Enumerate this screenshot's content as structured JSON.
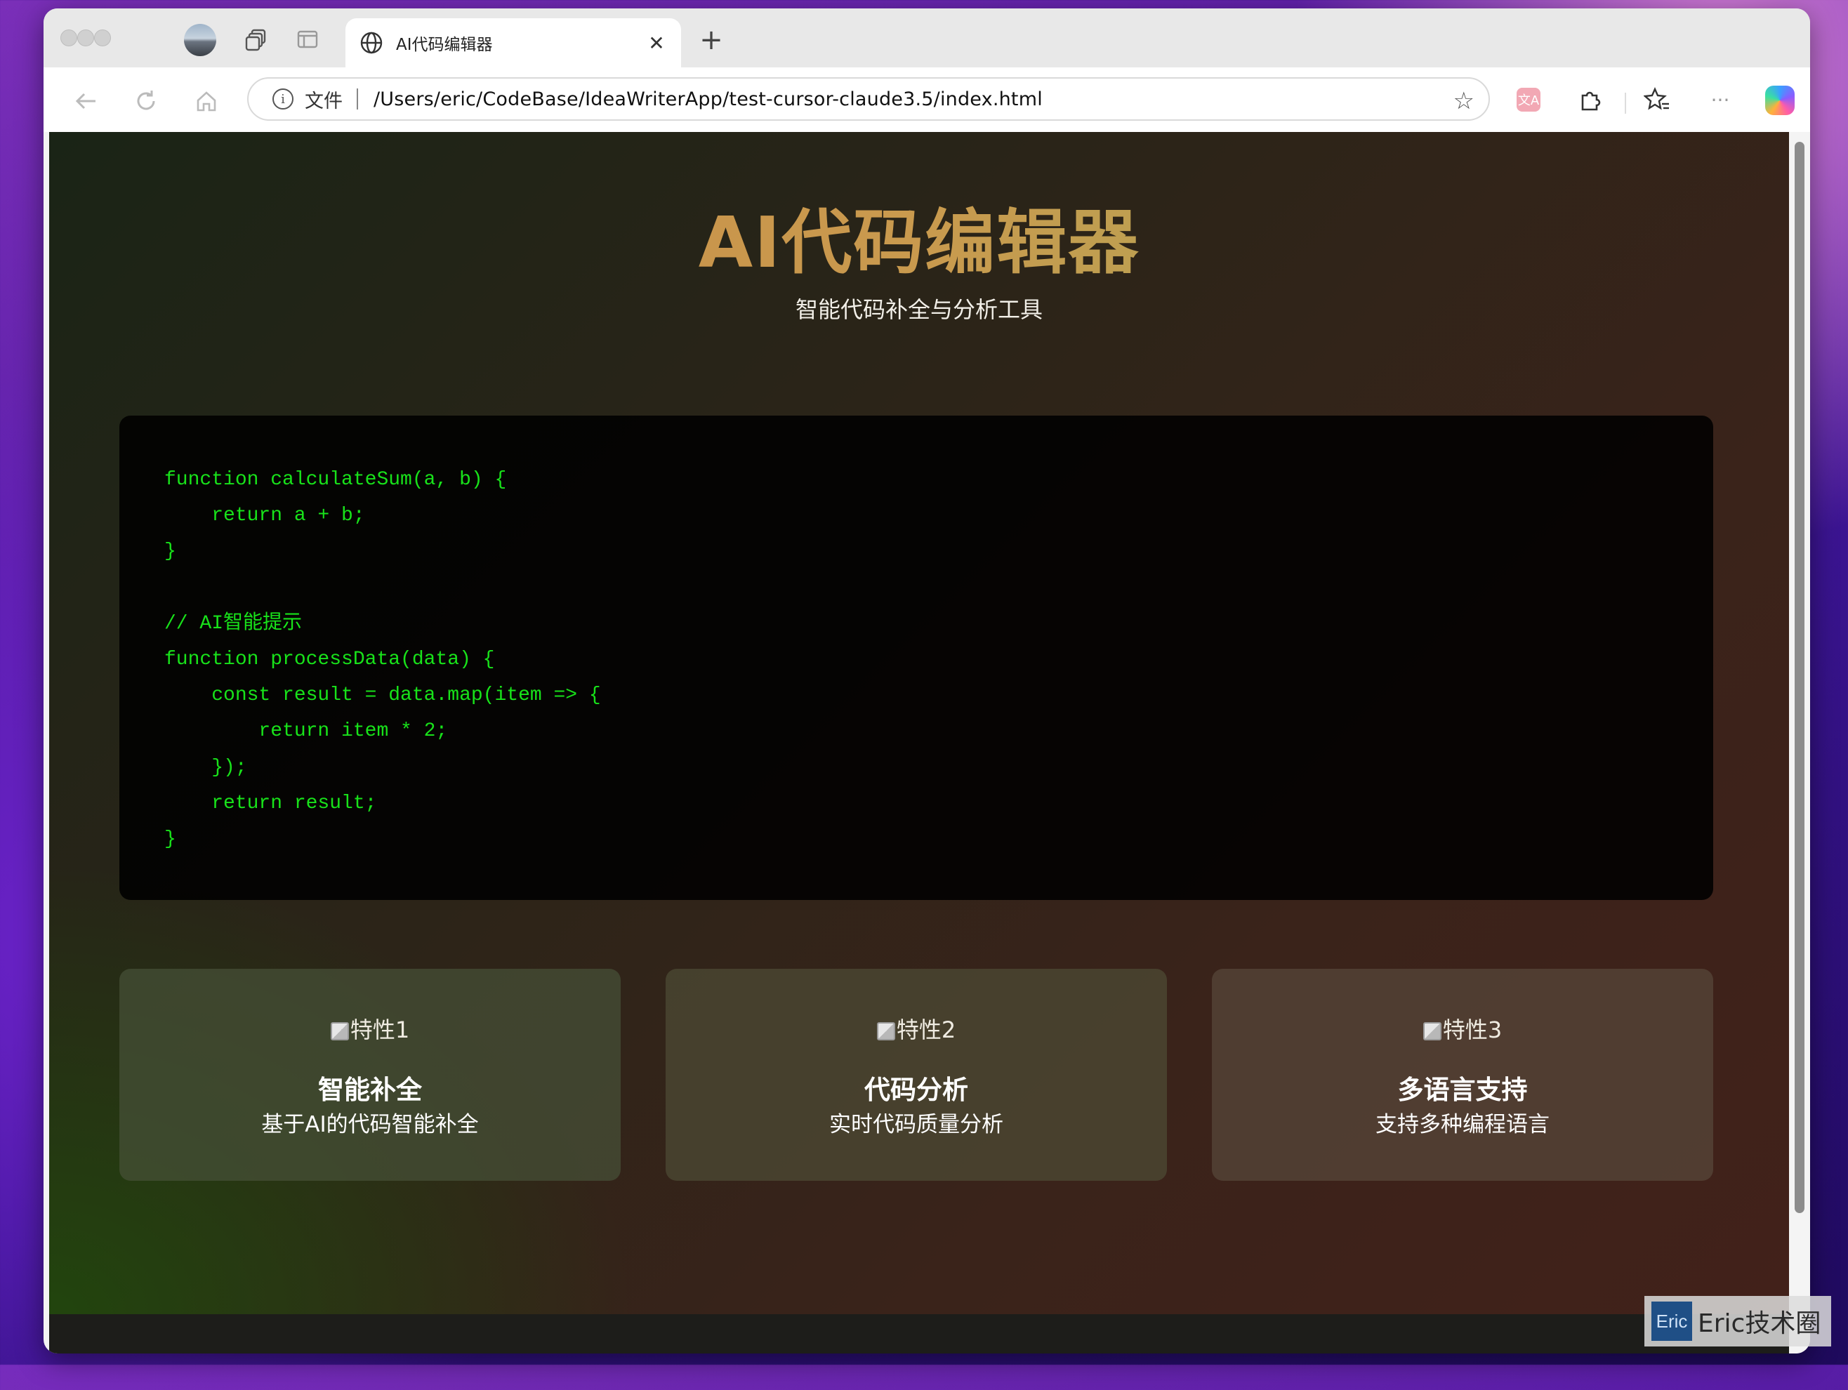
{
  "browser": {
    "tab_title": "AI代码编辑器",
    "url_scheme_label": "文件",
    "url_path": "/Users/eric/CodeBase/IdeaWriterApp/test-cursor-claude3.5/index.html",
    "translate_label": "文A"
  },
  "hero": {
    "title": "AI代码编辑器",
    "subtitle": "智能代码补全与分析工具"
  },
  "code": {
    "lines": [
      "function calculateSum(a, b) {",
      "    return a + b;",
      "}",
      "",
      "// AI智能提示",
      "function processData(data) {",
      "    const result = data.map(item => {",
      "        return item * 2;",
      "    });",
      "    return result;",
      "}"
    ]
  },
  "features": [
    {
      "img_alt": "特性1",
      "title": "智能补全",
      "desc": "基于AI的代码智能补全"
    },
    {
      "img_alt": "特性2",
      "title": "代码分析",
      "desc": "实时代码质量分析"
    },
    {
      "img_alt": "特性3",
      "title": "多语言支持",
      "desc": "支持多种编程语言"
    }
  ],
  "watermark": {
    "logo_text": "Eric",
    "text": "Eric技术圈"
  },
  "colors": {
    "code_text": "#18e21a",
    "title_gradient_start": "#c98a46",
    "title_gradient_end": "#9fae59"
  }
}
